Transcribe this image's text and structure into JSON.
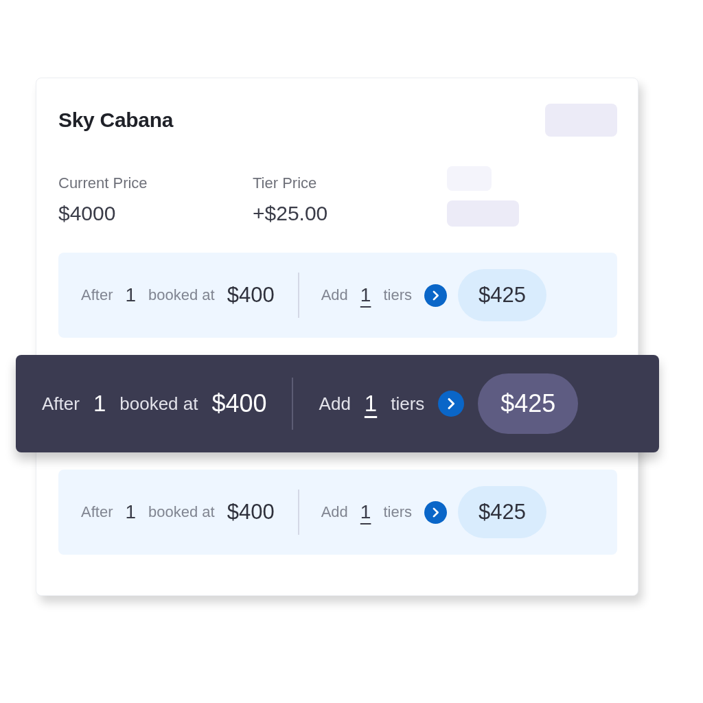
{
  "card": {
    "title": "Sky Cabana",
    "prices": [
      {
        "label": "Current Price",
        "value": "$4000"
      },
      {
        "label": "Tier Price",
        "value": "+$25.00"
      }
    ],
    "tiers": [
      {
        "selected": false,
        "after_label": "After",
        "count": "1",
        "booked_label": "booked at",
        "booked_price": "$400",
        "add_label": "Add",
        "tiers_count": "1",
        "tiers_label": "tiers",
        "result_price": "$425"
      },
      {
        "selected": true,
        "after_label": "After",
        "count": "1",
        "booked_label": "booked at",
        "booked_price": "$400",
        "add_label": "Add",
        "tiers_count": "1",
        "tiers_label": "tiers",
        "result_price": "$425"
      },
      {
        "selected": false,
        "after_label": "After",
        "count": "1",
        "booked_label": "booked at",
        "booked_price": "$400",
        "add_label": "Add",
        "tiers_count": "1",
        "tiers_label": "tiers",
        "result_price": "$425"
      }
    ]
  }
}
